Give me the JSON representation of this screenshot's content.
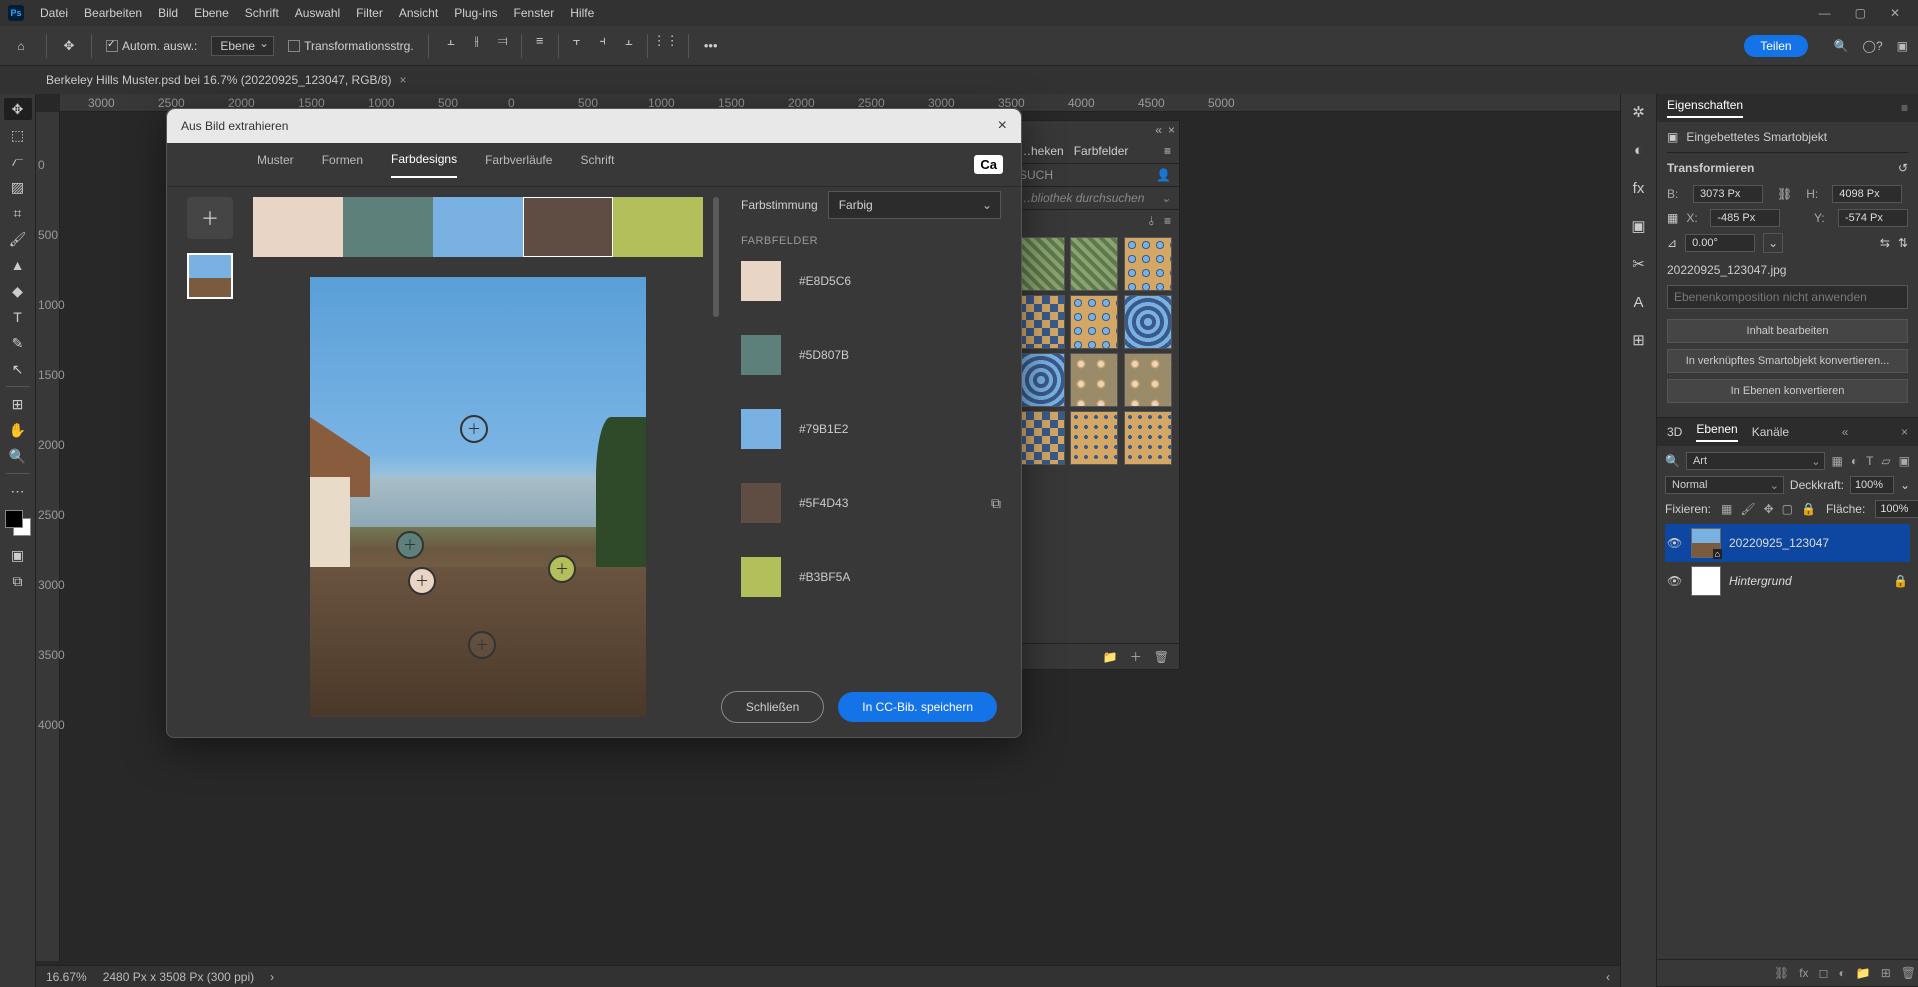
{
  "menubar": [
    "Datei",
    "Bearbeiten",
    "Bild",
    "Ebene",
    "Schrift",
    "Auswahl",
    "Filter",
    "Ansicht",
    "Plug-ins",
    "Fenster",
    "Hilfe"
  ],
  "optbar": {
    "auto_select": "Autom. ausw.:",
    "target": "Ebene",
    "transform": "Transformationsstrg.",
    "more": "•••"
  },
  "share": "Teilen",
  "doc_tab": "Berkeley Hills Muster.psd bei 16.7% (20220925_123047, RGB/8)",
  "ruler_h": [
    "3000",
    "2500",
    "2000",
    "1500",
    "1000",
    "500",
    "0",
    "500",
    "1000",
    "1500",
    "2000",
    "2500",
    "3000",
    "3500",
    "4000",
    "4500",
    "5000"
  ],
  "ruler_v": [
    "0",
    "500",
    "1000",
    "1500",
    "2000",
    "2500",
    "3000",
    "3500",
    "4000"
  ],
  "status": {
    "zoom": "16.67%",
    "doc": "2480 Px x 3508 Px (300 ppi)"
  },
  "dialog": {
    "title": "Aus Bild extrahieren",
    "tabs": [
      "Muster",
      "Formen",
      "Farbdesigns",
      "Farbverläufe",
      "Schrift"
    ],
    "active_tab": 2,
    "mood_label": "Farbstimmung",
    "mood_value": "Farbig",
    "section": "FARBFELDER",
    "colors": [
      {
        "hex": "#E8D5C6"
      },
      {
        "hex": "#5D807B"
      },
      {
        "hex": "#79B1E2"
      },
      {
        "hex": "#5F4D43"
      },
      {
        "hex": "#B3BF5A"
      }
    ],
    "close": "Schließen",
    "save": "In CC-Bib. speichern"
  },
  "lib": {
    "tab1": "…heken",
    "tab2": "Farbfelder",
    "search_scope": "SUCH",
    "search_ph": "…bliothek durchsuchen"
  },
  "properties": {
    "title": "Eigenschaften",
    "type": "Eingebettetes Smartobjekt",
    "section": "Transformieren",
    "w_lbl": "B:",
    "w": "3073 Px",
    "h_lbl": "H:",
    "h": "4098 Px",
    "x_lbl": "X:",
    "x": "-485 Px",
    "y_lbl": "Y:",
    "y": "-574 Px",
    "angle": "0.00°",
    "file": "20220925_123047.jpg",
    "comp_ph": "Ebenenkomposition nicht anwenden",
    "btn1": "Inhalt bearbeiten",
    "btn2": "In verknüpftes Smartobjekt konvertieren...",
    "btn3": "In Ebenen konvertieren"
  },
  "layers": {
    "tabs": [
      "3D",
      "Ebenen",
      "Kanäle"
    ],
    "active": 1,
    "filter": "Art",
    "blend": "Normal",
    "opacity_lbl": "Deckkraft:",
    "opacity": "100%",
    "fix_lbl": "Fixieren:",
    "fill_lbl": "Fläche:",
    "fill": "100%",
    "layer1": "20220925_123047",
    "layer2": "Hintergrund"
  }
}
